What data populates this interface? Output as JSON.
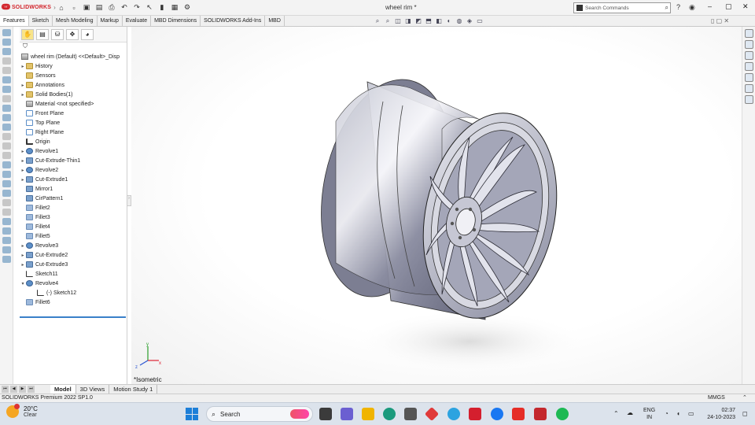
{
  "app": {
    "logo_text": "SOLIDWORKS",
    "document_title": "wheel rim *",
    "search_placeholder": "Search Commands"
  },
  "ribbon_tabs": [
    "Features",
    "Sketch",
    "Mesh Modeling",
    "Markup",
    "Evaluate",
    "MBD Dimensions",
    "SOLIDWORKS Add-Ins",
    "MBD"
  ],
  "active_ribbon_tab": "Features",
  "tree": {
    "root_label": "wheel rim (Default) <<Default>_Disp",
    "items": [
      {
        "label": "History",
        "icon": "folder",
        "expand": "▸"
      },
      {
        "label": "Sensors",
        "icon": "folder",
        "expand": ""
      },
      {
        "label": "Annotations",
        "icon": "folder",
        "expand": "▸"
      },
      {
        "label": "Solid Bodies(1)",
        "icon": "folder",
        "expand": "▸"
      },
      {
        "label": "Material <not specified>",
        "icon": "mat",
        "expand": ""
      },
      {
        "label": "Front Plane",
        "icon": "plane",
        "expand": ""
      },
      {
        "label": "Top Plane",
        "icon": "plane",
        "expand": ""
      },
      {
        "label": "Right Plane",
        "icon": "plane",
        "expand": ""
      },
      {
        "label": "Origin",
        "icon": "origin",
        "expand": ""
      },
      {
        "label": "Revolve1",
        "icon": "feat",
        "expand": "▸"
      },
      {
        "label": "Cut-Extrude-Thin1",
        "icon": "cut",
        "expand": "▸"
      },
      {
        "label": "Revolve2",
        "icon": "feat",
        "expand": "▸"
      },
      {
        "label": "Cut-Extrude1",
        "icon": "cut",
        "expand": "▸"
      },
      {
        "label": "Mirror1",
        "icon": "cut",
        "expand": ""
      },
      {
        "label": "CirPattern1",
        "icon": "cut",
        "expand": ""
      },
      {
        "label": "Fillet2",
        "icon": "fillet",
        "expand": ""
      },
      {
        "label": "Fillet3",
        "icon": "fillet",
        "expand": ""
      },
      {
        "label": "Fillet4",
        "icon": "fillet",
        "expand": ""
      },
      {
        "label": "Fillet5",
        "icon": "fillet",
        "expand": ""
      },
      {
        "label": "Revolve3",
        "icon": "feat",
        "expand": "▸"
      },
      {
        "label": "Cut-Extrude2",
        "icon": "cut",
        "expand": "▸"
      },
      {
        "label": "Cut-Extrude3",
        "icon": "cut",
        "expand": "▸"
      },
      {
        "label": "Sketch11",
        "icon": "sketch",
        "expand": ""
      },
      {
        "label": "Revolve4",
        "icon": "feat",
        "expand": "▾"
      },
      {
        "label": "(-) Sketch12",
        "icon": "sketch",
        "expand": "",
        "indent": true
      },
      {
        "label": "Fillet6",
        "icon": "fillet",
        "expand": ""
      }
    ]
  },
  "viewport": {
    "view_orientation": "*Isometric",
    "triad_labels": {
      "x": "x",
      "y": "y",
      "z": "z"
    }
  },
  "bottom_tabs": [
    "Model",
    "3D Views",
    "Motion Study 1"
  ],
  "active_bottom_tab": "Model",
  "status": {
    "product": "SOLIDWORKS Premium 2022 SP1.0",
    "units": "MMGS"
  },
  "taskbar": {
    "temperature": "20°C",
    "weather": "Clear",
    "search_label": "Search",
    "language_line1": "ENG",
    "language_line2": "IN",
    "time": "02:37",
    "date": "24-10-2023"
  }
}
